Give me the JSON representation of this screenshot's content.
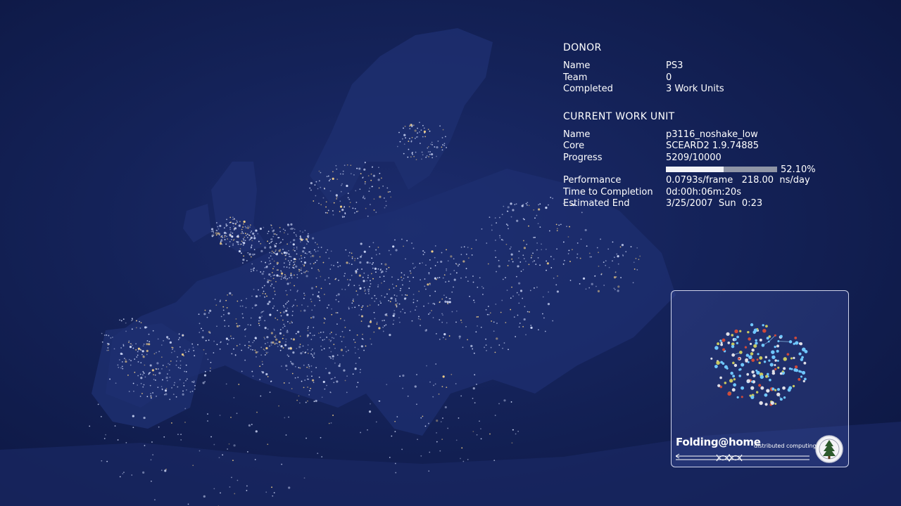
{
  "donor": {
    "heading": "DONOR",
    "name_label": "Name",
    "name_value": "PS3",
    "team_label": "Team",
    "team_value": "0",
    "completed_label": "Completed",
    "completed_value": "3 Work Units"
  },
  "work_unit": {
    "heading": "CURRENT WORK UNIT",
    "name_label": "Name",
    "name_value": "p3116_noshake_low",
    "core_label": "Core",
    "core_value": "SCEARD2 1.9.74885",
    "progress_label": "Progress",
    "progress_value": "5209/10000",
    "progress_fraction": 0.521,
    "progress_percent": "52.10%",
    "performance_label": "Performance",
    "performance_value": "0.0793s/frame   218.00  ns/day",
    "ttc_label": "Time to Completion",
    "ttc_value": "0d:00h:06m:20s",
    "end_label": "Estimated End",
    "end_value": "3/25/2007  Sun  0:23"
  },
  "logo": {
    "title": "Folding@home",
    "subtitle": "distributed computing"
  },
  "colors": {
    "background": "#142258",
    "land": "#1b2a66",
    "city_light": "#d9e2ff",
    "city_light_warm": "#ffd98a"
  }
}
